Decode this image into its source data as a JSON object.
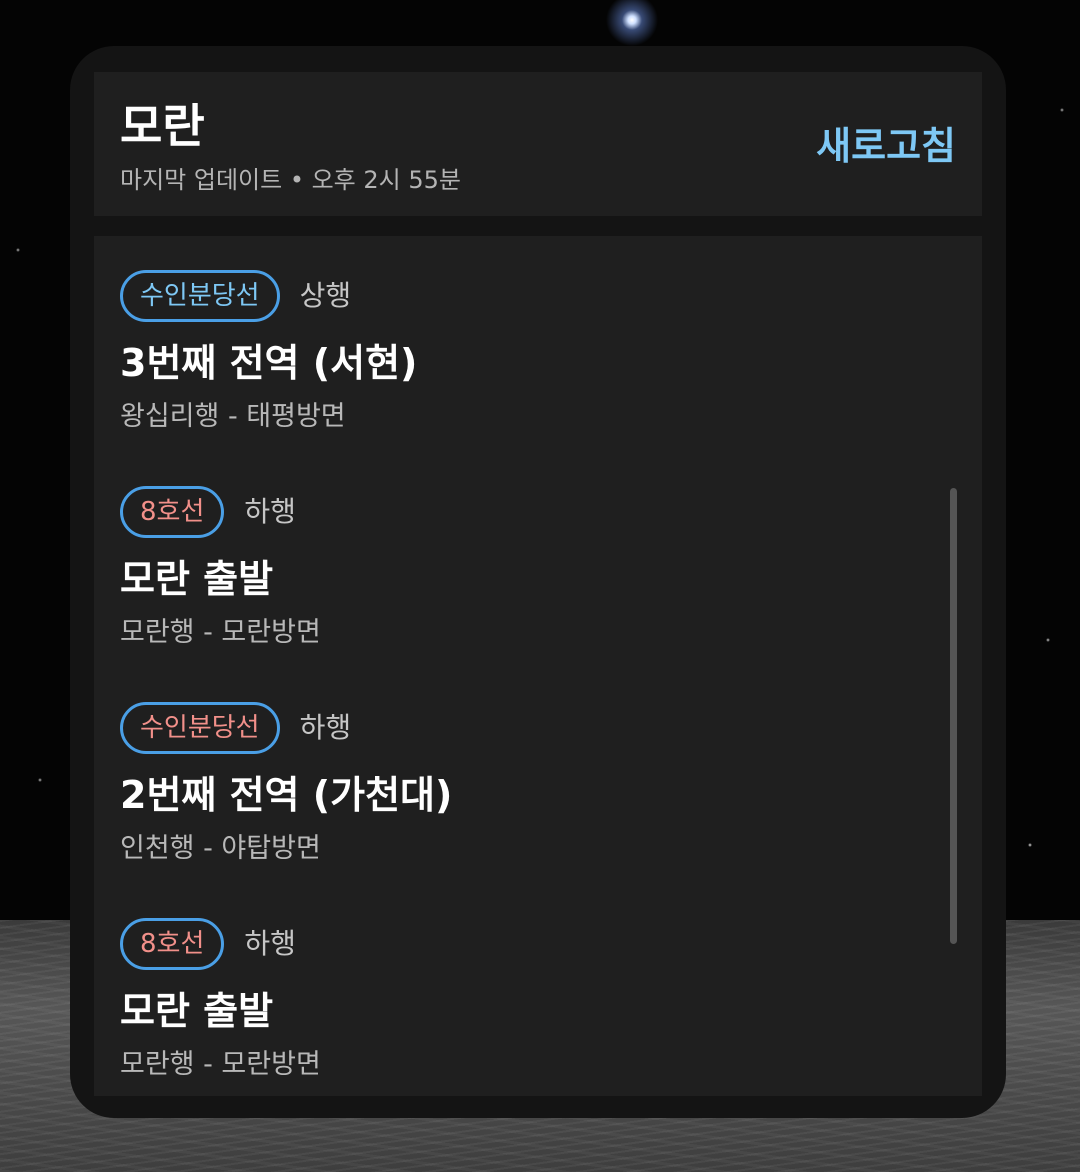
{
  "header": {
    "station": "모란",
    "last_updated": "마지막 업데이트 • 오후 2시 55분",
    "refresh_label": "새로고침"
  },
  "arrivals": [
    {
      "line": "수인분당선",
      "direction": "상행",
      "status": "3번째 전역 (서현)",
      "destination": "왕십리행 - 태평방면",
      "badge_border": "#4a9fe6",
      "badge_text_color": "#7ec8f5"
    },
    {
      "line": "8호선",
      "direction": "하행",
      "status": "모란 출발",
      "destination": "모란행 - 모란방면",
      "badge_border": "#4a9fe6",
      "badge_text_color": "#f2908a"
    },
    {
      "line": "수인분당선",
      "direction": "하행",
      "status": "2번째 전역 (가천대)",
      "destination": "인천행 - 야탑방면",
      "badge_border": "#4a9fe6",
      "badge_text_color": "#f2908a"
    },
    {
      "line": "8호선",
      "direction": "하행",
      "status": "모란 출발",
      "destination": "모란행 - 모란방면",
      "badge_border": "#4a9fe6",
      "badge_text_color": "#f2908a"
    }
  ],
  "colors": {
    "accent": "#7ec8f5",
    "panel": "#1f1f1f",
    "widget": "#141414"
  }
}
